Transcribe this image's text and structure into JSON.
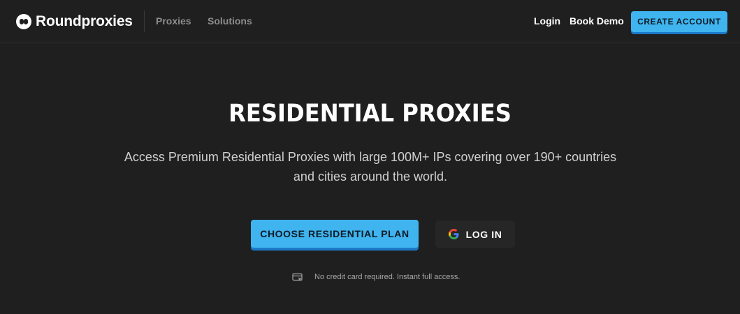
{
  "header": {
    "brand": "Roundproxies",
    "nav": [
      {
        "label": "Proxies"
      },
      {
        "label": "Solutions"
      }
    ],
    "login_label": "Login",
    "demo_label": "Book Demo",
    "create_label": "CREATE ACCOUNT"
  },
  "hero": {
    "title": "RESIDENTIAL PROXIES",
    "subtitle": "Access Premium Residential Proxies with large 100M+ IPs covering over 190+ countries and cities around the world.",
    "primary_cta": "CHOOSE RESIDENTIAL PLAN",
    "secondary_cta": "LOG IN",
    "note": "No credit card required. Instant full access."
  },
  "icons": {
    "brand": "roundproxies-logo-icon",
    "google": "google-g-icon",
    "card": "no-credit-card-icon"
  },
  "colors": {
    "background": "#1f1f1f",
    "accent": "#3fb4ef",
    "accent_shadow": "#1c79c8",
    "secondary_button": "#262626"
  }
}
